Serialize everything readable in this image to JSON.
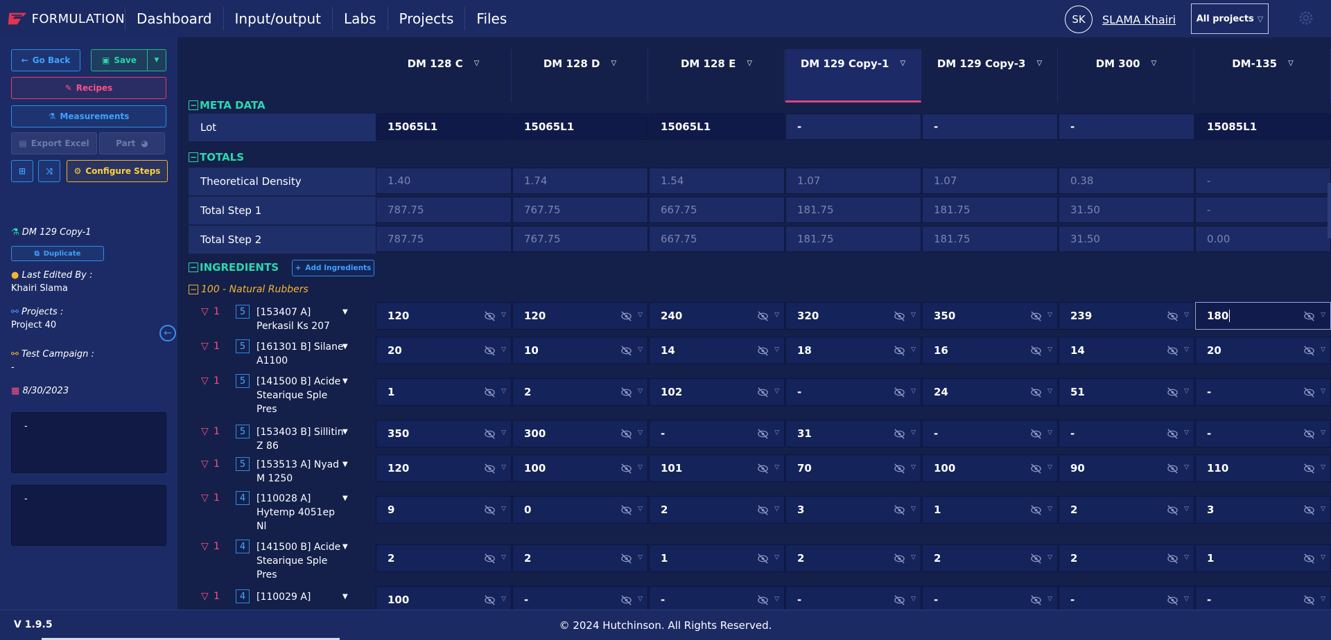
{
  "app": {
    "brand": "FORMULATION"
  },
  "nav": {
    "items": [
      "Dashboard",
      "Input/output",
      "Labs",
      "Projects",
      "Files"
    ]
  },
  "user": {
    "initials": "SK",
    "name": "SLAMA Khairi"
  },
  "project_selector": {
    "label": "All projects"
  },
  "sidebar": {
    "go_back": "Go Back",
    "save": "Save",
    "recipes": "Recipes",
    "measurements": "Measurements",
    "export_excel": "Export Excel",
    "part": "Part",
    "configure_steps": "Configure Steps",
    "recipe_name": "DM 129 Copy-1",
    "duplicate": "Duplicate",
    "last_edited_label": "Last Edited By :",
    "last_edited_value": "Khairi Slama",
    "projects_label": "Projects :",
    "projects_value": "Project 40",
    "test_campaign_label": "Test Campaign :",
    "test_campaign_value": "-",
    "date": "8/30/2023",
    "notes1": "-",
    "notes2": "-"
  },
  "columns": [
    "DM 128 C",
    "DM 128 D",
    "DM 128 E",
    "DM 129 Copy-1",
    "DM 129 Copy-3",
    "DM 300",
    "DM-135"
  ],
  "active_column": 3,
  "sections": {
    "meta": "META DATA",
    "totals": "TOTALS",
    "ingredients": "INGREDIENTS",
    "add_ingredients": "Add Ingredients"
  },
  "meta_rows": [
    {
      "label": "Lot",
      "values": [
        "15065L1",
        "15065L1",
        "15065L1",
        "-",
        "-",
        "-",
        "15085L1"
      ]
    }
  ],
  "total_rows": [
    {
      "label": "Theoretical Density",
      "values": [
        "1.40",
        "1.74",
        "1.54",
        "1.07",
        "1.07",
        "0.38",
        "-"
      ]
    },
    {
      "label": "Total Step 1",
      "values": [
        "787.75",
        "767.75",
        "667.75",
        "181.75",
        "181.75",
        "31.50",
        "-"
      ]
    },
    {
      "label": "Total Step 2",
      "values": [
        "787.75",
        "767.75",
        "667.75",
        "181.75",
        "181.75",
        "31.50",
        "0.00"
      ]
    }
  ],
  "ingredient_group": "100 - Natural Rubbers",
  "ingredients": [
    {
      "flag": "1",
      "step": "5",
      "name": "[153407 A] Perkasil Ks 207",
      "values": [
        "120",
        "120",
        "240",
        "320",
        "350",
        "239",
        "180"
      ]
    },
    {
      "flag": "1",
      "step": "5",
      "name": "[161301 B] Silane A1100",
      "values": [
        "20",
        "10",
        "14",
        "18",
        "16",
        "14",
        "20"
      ]
    },
    {
      "flag": "1",
      "step": "5",
      "name": "[141500 B] Acide Stearique Sple Pres",
      "values": [
        "1",
        "2",
        "102",
        "-",
        "24",
        "51",
        "-"
      ]
    },
    {
      "flag": "1",
      "step": "5",
      "name": "[153403 B] Sillitin Z 86",
      "values": [
        "350",
        "300",
        "-",
        "31",
        "-",
        "-",
        "-"
      ]
    },
    {
      "flag": "1",
      "step": "5",
      "name": "[153513 A] Nyad M 1250",
      "values": [
        "120",
        "100",
        "101",
        "70",
        "100",
        "90",
        "110"
      ]
    },
    {
      "flag": "1",
      "step": "4",
      "name": "[110028 A] Hytemp 4051ep Nl",
      "values": [
        "9",
        "0",
        "2",
        "3",
        "1",
        "2",
        "3"
      ]
    },
    {
      "flag": "1",
      "step": "4",
      "name": "[141500 B] Acide Stearique Sple Pres",
      "values": [
        "2",
        "2",
        "1",
        "2",
        "2",
        "2",
        "1"
      ]
    },
    {
      "flag": "1",
      "step": "4",
      "name": "[110029 A]",
      "values": [
        "100",
        "-",
        "-",
        "-",
        "-",
        "-",
        "-"
      ]
    }
  ],
  "footer": {
    "version": "V 1.9.5",
    "copyright": "© 2024 Hutchinson. All Rights Reserved."
  },
  "colors": {
    "accent_pink": "#e2407a",
    "accent_teal": "#2bd8b0",
    "accent_blue": "#2c8ee8",
    "group_yellow": "#f2b530"
  }
}
